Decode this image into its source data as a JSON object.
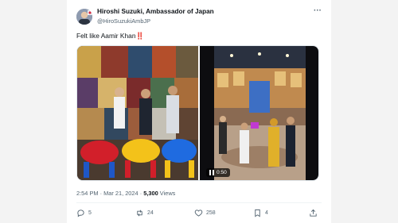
{
  "tweet": {
    "author_name": "Hiroshi Suzuki, Ambassador of Japan",
    "author_handle": "@HiroSuzukiAmbJP",
    "text": "Felt like Aamir Khan",
    "text_emoji": "‼️",
    "video_duration": "0:50",
    "timestamp": "2:54 PM · Mar 21, 2024",
    "views_count": "5,300",
    "views_label": "Views",
    "actions": {
      "replies": "5",
      "retweets": "24",
      "likes": "258",
      "bookmarks": "4"
    }
  },
  "icons": [
    "more-icon",
    "reply-icon",
    "retweet-icon",
    "like-icon",
    "bookmark-icon",
    "share-icon",
    "play-icon"
  ],
  "colors": {
    "accent_red": "#e0245e",
    "text": "#0f1419",
    "muted": "#536471"
  }
}
